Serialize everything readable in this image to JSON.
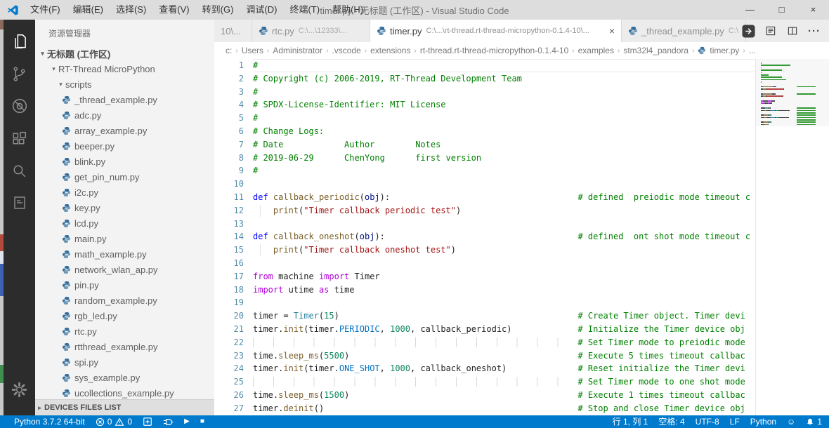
{
  "title_bar": {
    "title": "timer.py - 无标题 (工作区) - Visual Studio Code",
    "menus": [
      "文件(F)",
      "编辑(E)",
      "选择(S)",
      "查看(V)",
      "转到(G)",
      "调试(D)",
      "终端(T)",
      "帮助(H)"
    ],
    "controls": {
      "minimize": "—",
      "maximize": "□",
      "close": "×"
    }
  },
  "activity_bar": {
    "icons": [
      "explorer",
      "source-control",
      "debug-disabled",
      "extensions",
      "search",
      "docs"
    ],
    "bottom_icons": [
      "settings-gear"
    ],
    "active_icon": "explorer"
  },
  "explorer": {
    "header": "资源管理器",
    "workspace": "无标题 (工作区)",
    "folders": [
      "RT-Thread MicroPython",
      "scripts"
    ],
    "files": [
      "_thread_example.py",
      "adc.py",
      "array_example.py",
      "beeper.py",
      "blink.py",
      "get_pin_num.py",
      "i2c.py",
      "key.py",
      "lcd.py",
      "main.py",
      "math_example.py",
      "network_wlan_ap.py",
      "pin.py",
      "random_example.py",
      "rgb_led.py",
      "rtc.py",
      "rtthread_example.py",
      "spi.py",
      "sys_example.py",
      "ucollections_example.py"
    ],
    "devices_header": "DEVICES FILES LIST"
  },
  "tabs": {
    "items": [
      {
        "label": "10\\...",
        "partial": true
      },
      {
        "label": "rtc.py",
        "desc": "C:\\...\\12333\\...",
        "icon": "python"
      },
      {
        "label": "timer.py",
        "desc": "C:\\...\\rt-thread.rt-thread-micropython-0.1.4-10\\...",
        "icon": "python",
        "active": true,
        "close": "×"
      },
      {
        "label": "_thread_example.py",
        "desc": "C:\\",
        "icon": "python"
      }
    ]
  },
  "editor_actions": [
    "rt-thread-download",
    "open-preview",
    "split-editor",
    "more-actions"
  ],
  "breadcrumb": {
    "separator": "›",
    "items": [
      {
        "label": "c:"
      },
      {
        "label": "Users"
      },
      {
        "label": "Administrator"
      },
      {
        "label": ".vscode"
      },
      {
        "label": "extensions"
      },
      {
        "label": "rt-thread.rt-thread-micropython-0.1.4-10"
      },
      {
        "label": "examples"
      },
      {
        "label": "stm32l4_pandora"
      },
      {
        "label": "timer.py",
        "icon": "python"
      },
      {
        "label": "..."
      }
    ]
  },
  "editor": {
    "language": "python",
    "syntax_colors": {
      "cm": "#008000",
      "kw": "#0000ff",
      "ctl": "#af00db",
      "fn": "#795e26",
      "str": "#a31515",
      "num": "#098658",
      "cls": "#267f99",
      "cst": "#0070c1",
      "prm": "#001080",
      "pl": "#1e1e1e"
    },
    "lines": [
      {
        "tk": [
          [
            "cm",
            "#"
          ]
        ]
      },
      {
        "tk": [
          [
            "cm",
            "# Copyright (c) 2006-2019, RT-Thread Development Team"
          ]
        ]
      },
      {
        "tk": [
          [
            "cm",
            "#"
          ]
        ]
      },
      {
        "tk": [
          [
            "cm",
            "# SPDX-License-Identifier: MIT License"
          ]
        ]
      },
      {
        "tk": [
          [
            "cm",
            "#"
          ]
        ]
      },
      {
        "tk": [
          [
            "cm",
            "# Change Logs:"
          ]
        ]
      },
      {
        "tk": [
          [
            "cm",
            "# Date            Author        Notes"
          ]
        ]
      },
      {
        "tk": [
          [
            "cm",
            "# 2019-06-29      ChenYong      first version"
          ]
        ]
      },
      {
        "tk": [
          [
            "cm",
            "#"
          ]
        ]
      },
      {
        "tk": []
      },
      {
        "tk": [
          [
            "kw",
            "def"
          ],
          [
            "pl",
            " "
          ],
          [
            "fn",
            "callback_periodic"
          ],
          [
            "pl",
            "("
          ],
          [
            "prm",
            "obj"
          ],
          [
            "pl",
            "):"
          ],
          [
            "pad",
            37
          ],
          [
            "cm",
            "# defined  preiodic mode timeout c"
          ]
        ]
      },
      {
        "g": "s",
        "tk": [
          [
            "pl",
            "    "
          ],
          [
            "fn",
            "print"
          ],
          [
            "pl",
            "("
          ],
          [
            "str",
            "\"Timer callback periodic test\""
          ],
          [
            "pl",
            ")"
          ]
        ]
      },
      {
        "tk": []
      },
      {
        "tk": [
          [
            "kw",
            "def"
          ],
          [
            "pl",
            " "
          ],
          [
            "fn",
            "callback_oneshot"
          ],
          [
            "pl",
            "("
          ],
          [
            "prm",
            "obj"
          ],
          [
            "pl",
            "):"
          ],
          [
            "pad",
            38
          ],
          [
            "cm",
            "# defined  ont shot mode timeout c"
          ]
        ]
      },
      {
        "g": "s",
        "tk": [
          [
            "pl",
            "    "
          ],
          [
            "fn",
            "print"
          ],
          [
            "pl",
            "("
          ],
          [
            "str",
            "\"Timer callback oneshot test\""
          ],
          [
            "pl",
            ")"
          ]
        ]
      },
      {
        "tk": []
      },
      {
        "tk": [
          [
            "ctl",
            "from"
          ],
          [
            "pl",
            " machine "
          ],
          [
            "ctl",
            "import"
          ],
          [
            "pl",
            " Timer"
          ]
        ]
      },
      {
        "tk": [
          [
            "ctl",
            "import"
          ],
          [
            "pl",
            " utime "
          ],
          [
            "ctl",
            "as"
          ],
          [
            "pl",
            " time"
          ]
        ]
      },
      {
        "tk": []
      },
      {
        "tk": [
          [
            "pl",
            "timer = "
          ],
          [
            "cls",
            "Timer"
          ],
          [
            "pl",
            "("
          ],
          [
            "num",
            "15"
          ],
          [
            "pl",
            ")"
          ],
          [
            "pad",
            47
          ],
          [
            "cm",
            "# Create Timer object. Timer devi"
          ]
        ]
      },
      {
        "tk": [
          [
            "pl",
            "timer."
          ],
          [
            "fn",
            "init"
          ],
          [
            "pl",
            "(timer."
          ],
          [
            "cst",
            "PERIODIC"
          ],
          [
            "pl",
            ", "
          ],
          [
            "num",
            "1000"
          ],
          [
            "pl",
            ", callback_periodic)"
          ],
          [
            "pad",
            13
          ],
          [
            "cm",
            "# Initialize the Timer device obj"
          ]
        ]
      },
      {
        "tk": [
          [
            "gdp",
            64
          ],
          [
            "cm",
            "# Set Timer mode to preiodic mode"
          ]
        ]
      },
      {
        "tk": [
          [
            "pl",
            "time."
          ],
          [
            "fn",
            "sleep_ms"
          ],
          [
            "pl",
            "("
          ],
          [
            "num",
            "5500"
          ],
          [
            "pl",
            ")"
          ],
          [
            "pad",
            45
          ],
          [
            "cm",
            "# Execute 5 times timeout callbac"
          ]
        ]
      },
      {
        "tk": [
          [
            "pl",
            "timer."
          ],
          [
            "fn",
            "init"
          ],
          [
            "pl",
            "(timer."
          ],
          [
            "cst",
            "ONE_SHOT"
          ],
          [
            "pl",
            ", "
          ],
          [
            "num",
            "1000"
          ],
          [
            "pl",
            ", callback_oneshot)"
          ],
          [
            "pad",
            14
          ],
          [
            "cm",
            "# Reset initialize the Timer devi"
          ]
        ]
      },
      {
        "tk": [
          [
            "gdp",
            64
          ],
          [
            "cm",
            "# Set Timer mode to one shot mode"
          ]
        ]
      },
      {
        "tk": [
          [
            "pl",
            "time."
          ],
          [
            "fn",
            "sleep_ms"
          ],
          [
            "pl",
            "("
          ],
          [
            "num",
            "1500"
          ],
          [
            "pl",
            ")"
          ],
          [
            "pad",
            45
          ],
          [
            "cm",
            "# Execute 1 times timeout callbac"
          ]
        ]
      },
      {
        "tk": [
          [
            "pl",
            "timer."
          ],
          [
            "fn",
            "deinit"
          ],
          [
            "pl",
            "()"
          ],
          [
            "pad",
            50
          ],
          [
            "cm",
            "# Stop and close Timer device obj"
          ]
        ]
      }
    ]
  },
  "status_bar": {
    "bg_color": "#007acc",
    "python_version": "Python 3.7.2 64-bit",
    "errors": "0",
    "warnings": "0",
    "line_col": "行 1, 列 1",
    "spaces": "空格: 4",
    "encoding": "UTF-8",
    "eol": "LF",
    "language": "Python",
    "bell_count": "1"
  }
}
